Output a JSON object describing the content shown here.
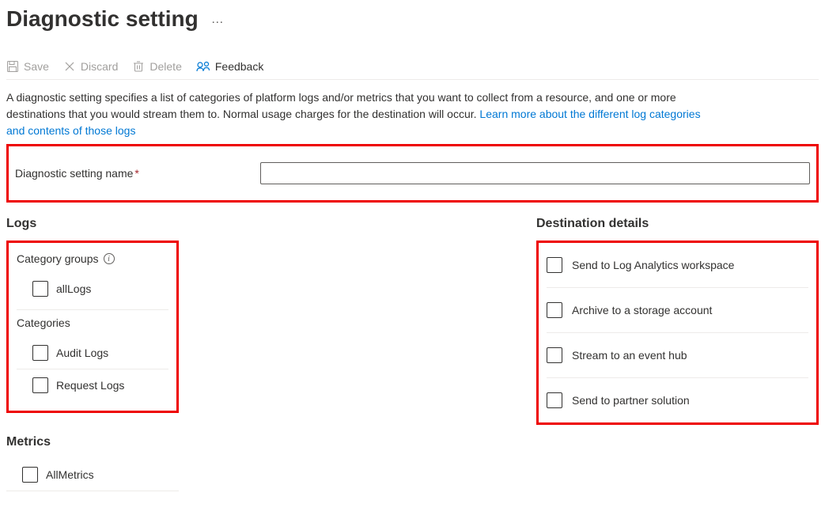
{
  "page": {
    "title": "Diagnostic setting",
    "ellipsis": "…"
  },
  "toolbar": {
    "save": "Save",
    "discard": "Discard",
    "delete": "Delete",
    "feedback": "Feedback"
  },
  "description": {
    "text1": "A diagnostic setting specifies a list of categories of platform logs and/or metrics that you want to collect from a resource, and one or more destinations that you would stream them to. Normal usage charges for the destination will occur. ",
    "link": "Learn more about the different log categories and contents of those logs"
  },
  "nameField": {
    "label": "Diagnostic setting name",
    "value": ""
  },
  "logs": {
    "title": "Logs",
    "categoryGroupsTitle": "Category groups",
    "categoryGroups": [
      {
        "label": "allLogs"
      }
    ],
    "categoriesTitle": "Categories",
    "categories": [
      {
        "label": "Audit Logs"
      },
      {
        "label": "Request Logs"
      }
    ]
  },
  "metrics": {
    "title": "Metrics",
    "items": [
      {
        "label": "AllMetrics"
      }
    ]
  },
  "destinations": {
    "title": "Destination details",
    "items": [
      {
        "label": "Send to Log Analytics workspace"
      },
      {
        "label": "Archive to a storage account"
      },
      {
        "label": "Stream to an event hub"
      },
      {
        "label": "Send to partner solution"
      }
    ]
  }
}
